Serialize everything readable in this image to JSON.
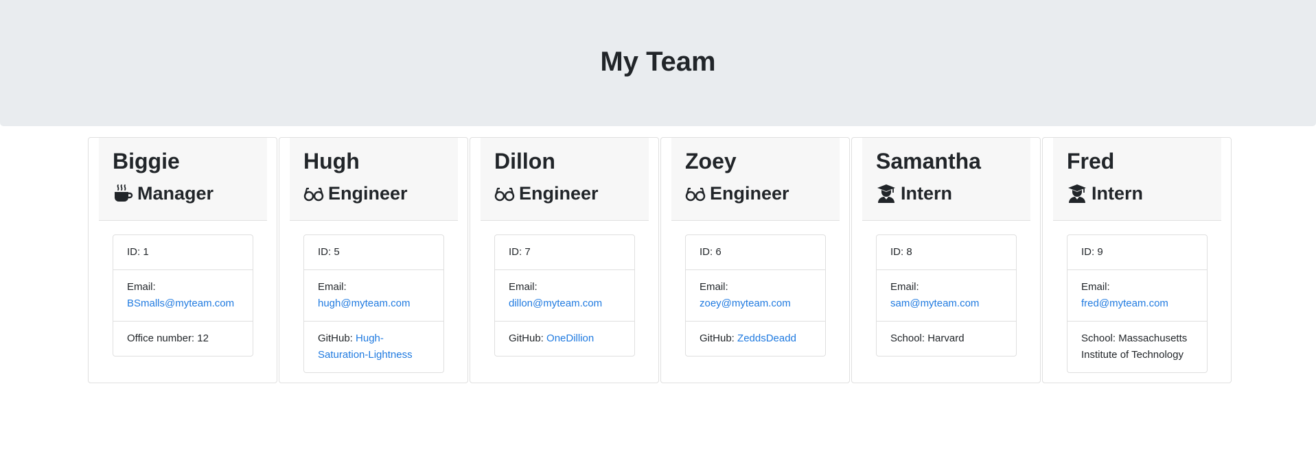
{
  "header": {
    "title": "My Team"
  },
  "colors": {
    "link": "#1f7ae0",
    "jumbotron_bg": "#e9ecef",
    "card_header_bg": "#f7f7f7"
  },
  "team": [
    {
      "name": "Biggie",
      "role": "Manager",
      "icon": "coffee-icon",
      "id_text": "ID: 1",
      "email_label": "Email:",
      "email": "BSmalls@myteam.com",
      "extra_label": "Office number: 12",
      "extra_link": ""
    },
    {
      "name": "Hugh",
      "role": "Engineer",
      "icon": "glasses-icon",
      "id_text": "ID: 5",
      "email_label": "Email:",
      "email": "hugh@myteam.com",
      "extra_label": "GitHub: ",
      "extra_link": "Hugh-Saturation-Lightness"
    },
    {
      "name": "Dillon",
      "role": "Engineer",
      "icon": "glasses-icon",
      "id_text": "ID: 7",
      "email_label": "Email:",
      "email": "dillon@myteam.com",
      "extra_label": "GitHub: ",
      "extra_link": "OneDillion"
    },
    {
      "name": "Zoey",
      "role": "Engineer",
      "icon": "glasses-icon",
      "id_text": "ID: 6",
      "email_label": "Email:",
      "email": "zoey@myteam.com",
      "extra_label": "GitHub: ",
      "extra_link": "ZeddsDeadd"
    },
    {
      "name": "Samantha",
      "role": "Intern",
      "icon": "graduate-icon",
      "id_text": "ID: 8",
      "email_label": "Email:",
      "email": "sam@myteam.com",
      "extra_label": "School: Harvard",
      "extra_link": ""
    },
    {
      "name": "Fred",
      "role": "Intern",
      "icon": "graduate-icon",
      "id_text": "ID: 9",
      "email_label": "Email:",
      "email": "fred@myteam.com",
      "extra_label": "School: Massachusetts Institute of Technology",
      "extra_link": ""
    }
  ]
}
